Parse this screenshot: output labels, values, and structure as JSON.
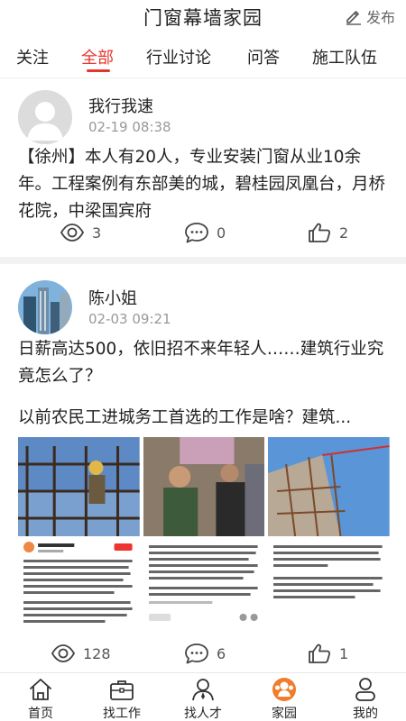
{
  "header": {
    "title": "门窗幕墙家园",
    "publish_label": "发布"
  },
  "tabs": [
    {
      "label": "关注"
    },
    {
      "label": "全部"
    },
    {
      "label": "行业讨论"
    },
    {
      "label": "问答"
    },
    {
      "label": "施工队伍"
    }
  ],
  "active_tab": "全部",
  "posts": [
    {
      "author": "我行我速",
      "time": "02-19 08:38",
      "content": "【徐州】本人有20人，专业安装门窗从业10余年。工程案例有东部美的城，碧桂园凤凰台，月桥花院，中梁国宾府",
      "views": "3",
      "comments": "0",
      "likes": "2"
    },
    {
      "author": "陈小姐",
      "time": "02-03 09:21",
      "content_line1": "日薪高达500，依旧招不来年轻人……建筑行业究竟怎么了？",
      "content_line2": "以前农民工进城务工首选的工作是啥？建筑...",
      "views": "128",
      "comments": "6",
      "likes": "1"
    }
  ],
  "bottom_nav": [
    {
      "label": "首页",
      "icon": "home-icon"
    },
    {
      "label": "找工作",
      "icon": "briefcase-icon"
    },
    {
      "label": "找人才",
      "icon": "person-search-icon"
    },
    {
      "label": "家园",
      "icon": "community-icon"
    },
    {
      "label": "我的",
      "icon": "profile-icon"
    }
  ],
  "colors": {
    "accent": "#e8342c",
    "nav_active": "#f07d2c",
    "muted": "#999999"
  }
}
